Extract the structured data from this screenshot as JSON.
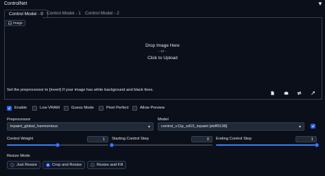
{
  "header": {
    "title": "ControlNet"
  },
  "tabs": [
    {
      "label": "Control Model - 0"
    },
    {
      "label": "Control Model - 1"
    },
    {
      "label": "Control Model - 2"
    }
  ],
  "upload": {
    "chip_label": "Image",
    "drop_line1": "Drop Image Here",
    "drop_or": "- or -",
    "drop_line2": "Click to Upload",
    "hint": "Set the preprocessor to [invert] If your image has white background and black lines."
  },
  "options": {
    "enable": {
      "label": "Enable",
      "checked": true
    },
    "low_vram": {
      "label": "Low VRAM",
      "checked": false
    },
    "guess_mode": {
      "label": "Guess Mode",
      "checked": false
    },
    "pixel_perfect": {
      "label": "Pixel Perfect",
      "checked": false
    },
    "allow_preview": {
      "label": "Allow Preview",
      "checked": false
    }
  },
  "preprocessor": {
    "label": "Preprocessor",
    "value": "inpaint_global_harmonious"
  },
  "model": {
    "label": "Model",
    "value": "control_v11p_sd15_inpaint [ebff9138]"
  },
  "sliders": {
    "control_weight": {
      "label": "Control Weight",
      "value": "1",
      "fraction": 0.5
    },
    "starting_step": {
      "label": "Starting Control Step",
      "value": "0",
      "fraction": 0.0
    },
    "ending_step": {
      "label": "Ending Control Step",
      "value": "1",
      "fraction": 1.0
    }
  },
  "resize": {
    "label": "Resize Mode",
    "options": [
      "Just Resize",
      "Crop and Resize",
      "Resize and Fill"
    ],
    "selected": "Crop and Resize"
  },
  "colors": {
    "accent": "#2563eb",
    "background": "#0b0f19"
  }
}
